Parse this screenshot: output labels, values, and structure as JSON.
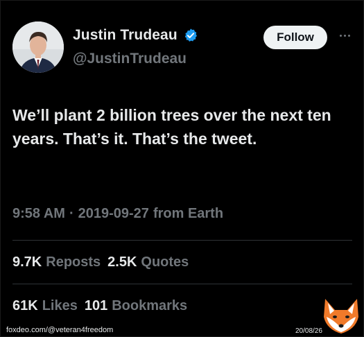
{
  "author": {
    "display_name": "Justin Trudeau",
    "handle": "@JustinTrudeau"
  },
  "actions": {
    "follow_label": "Follow"
  },
  "tweet": {
    "text": "We’ll plant 2 billion trees over the next ten years. That’s it. That’s the tweet.",
    "time": "9:58 AM",
    "separator": "·",
    "date": "2019-09-27",
    "source": "from Earth"
  },
  "stats": {
    "reposts_count": "9.7K",
    "reposts_label": "Reposts",
    "quotes_count": "2.5K",
    "quotes_label": "Quotes",
    "likes_count": "61K",
    "likes_label": "Likes",
    "bookmarks_count": "101",
    "bookmarks_label": "Bookmarks"
  },
  "watermark": {
    "site_text": "foxdeo.com/@veteran4freedom",
    "date_text": "20/08/26",
    "logo_icon": "fox-logo-icon"
  },
  "colors": {
    "background": "#000000",
    "text_primary": "#e7e9ea",
    "text_secondary": "#71767b",
    "verified_badge": "#1d9bf0",
    "follow_button_bg": "#eff3f4",
    "divider": "#2f3336",
    "fox_orange": "#f07a2a"
  }
}
